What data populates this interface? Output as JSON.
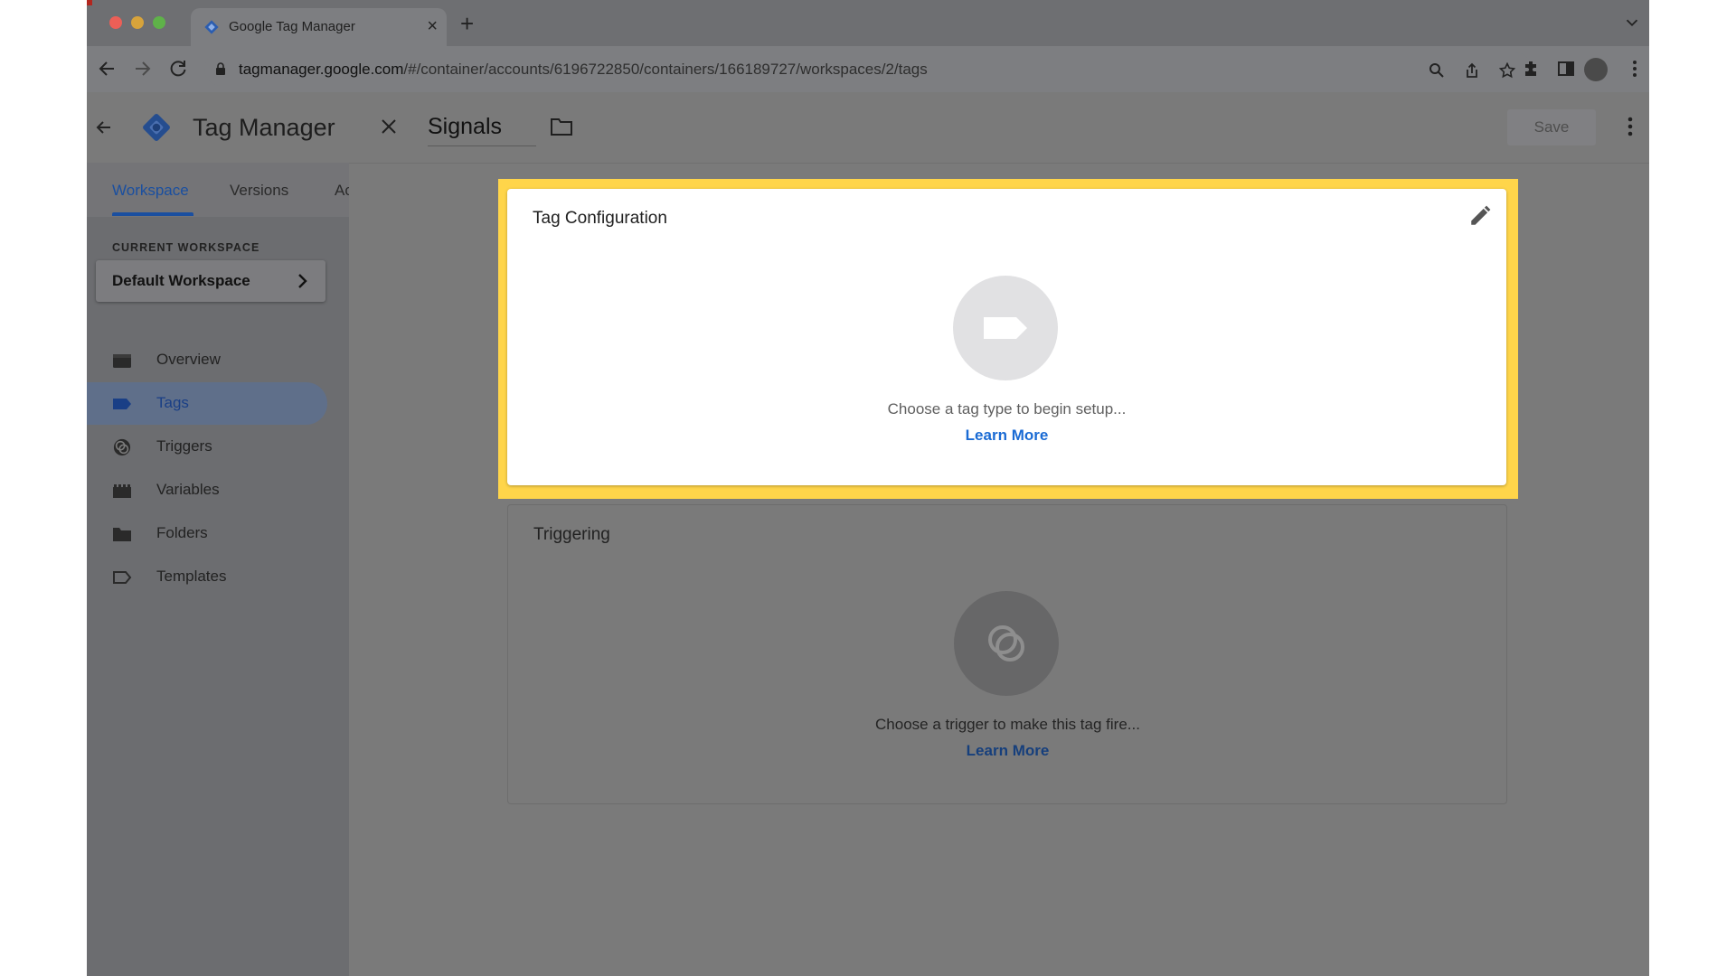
{
  "browser": {
    "tab_title": "Google Tag Manager",
    "tab_close": "×",
    "new_tab": "+",
    "url_domain": "tagmanager.google.com",
    "url_path": "/#/container/accounts/6196722850/containers/166189727/workspaces/2/tags"
  },
  "app": {
    "product_name": "Tag Manager",
    "workspace_tabs": [
      "Workspace",
      "Versions",
      "Ac"
    ],
    "current_workspace_label": "CURRENT WORKSPACE",
    "current_workspace_name": "Default Workspace",
    "nav": [
      {
        "label": "Overview",
        "icon": "overview-icon"
      },
      {
        "label": "Tags",
        "icon": "tag-icon",
        "active": true
      },
      {
        "label": "Triggers",
        "icon": "trigger-icon"
      },
      {
        "label": "Variables",
        "icon": "variables-icon"
      },
      {
        "label": "Folders",
        "icon": "folder-icon"
      },
      {
        "label": "Templates",
        "icon": "template-icon"
      }
    ]
  },
  "editor": {
    "tag_name": "Signals",
    "save_label": "Save",
    "tag_configuration": {
      "title": "Tag Configuration",
      "hint": "Choose a tag type to begin setup...",
      "learn_more": "Learn More"
    },
    "triggering": {
      "title": "Triggering",
      "hint": "Choose a trigger to make this tag fire...",
      "learn_more": "Learn More"
    }
  },
  "colors": {
    "highlight": "#ffd54a",
    "link": "#1a6bd4",
    "active_nav": "#1a3f86"
  }
}
